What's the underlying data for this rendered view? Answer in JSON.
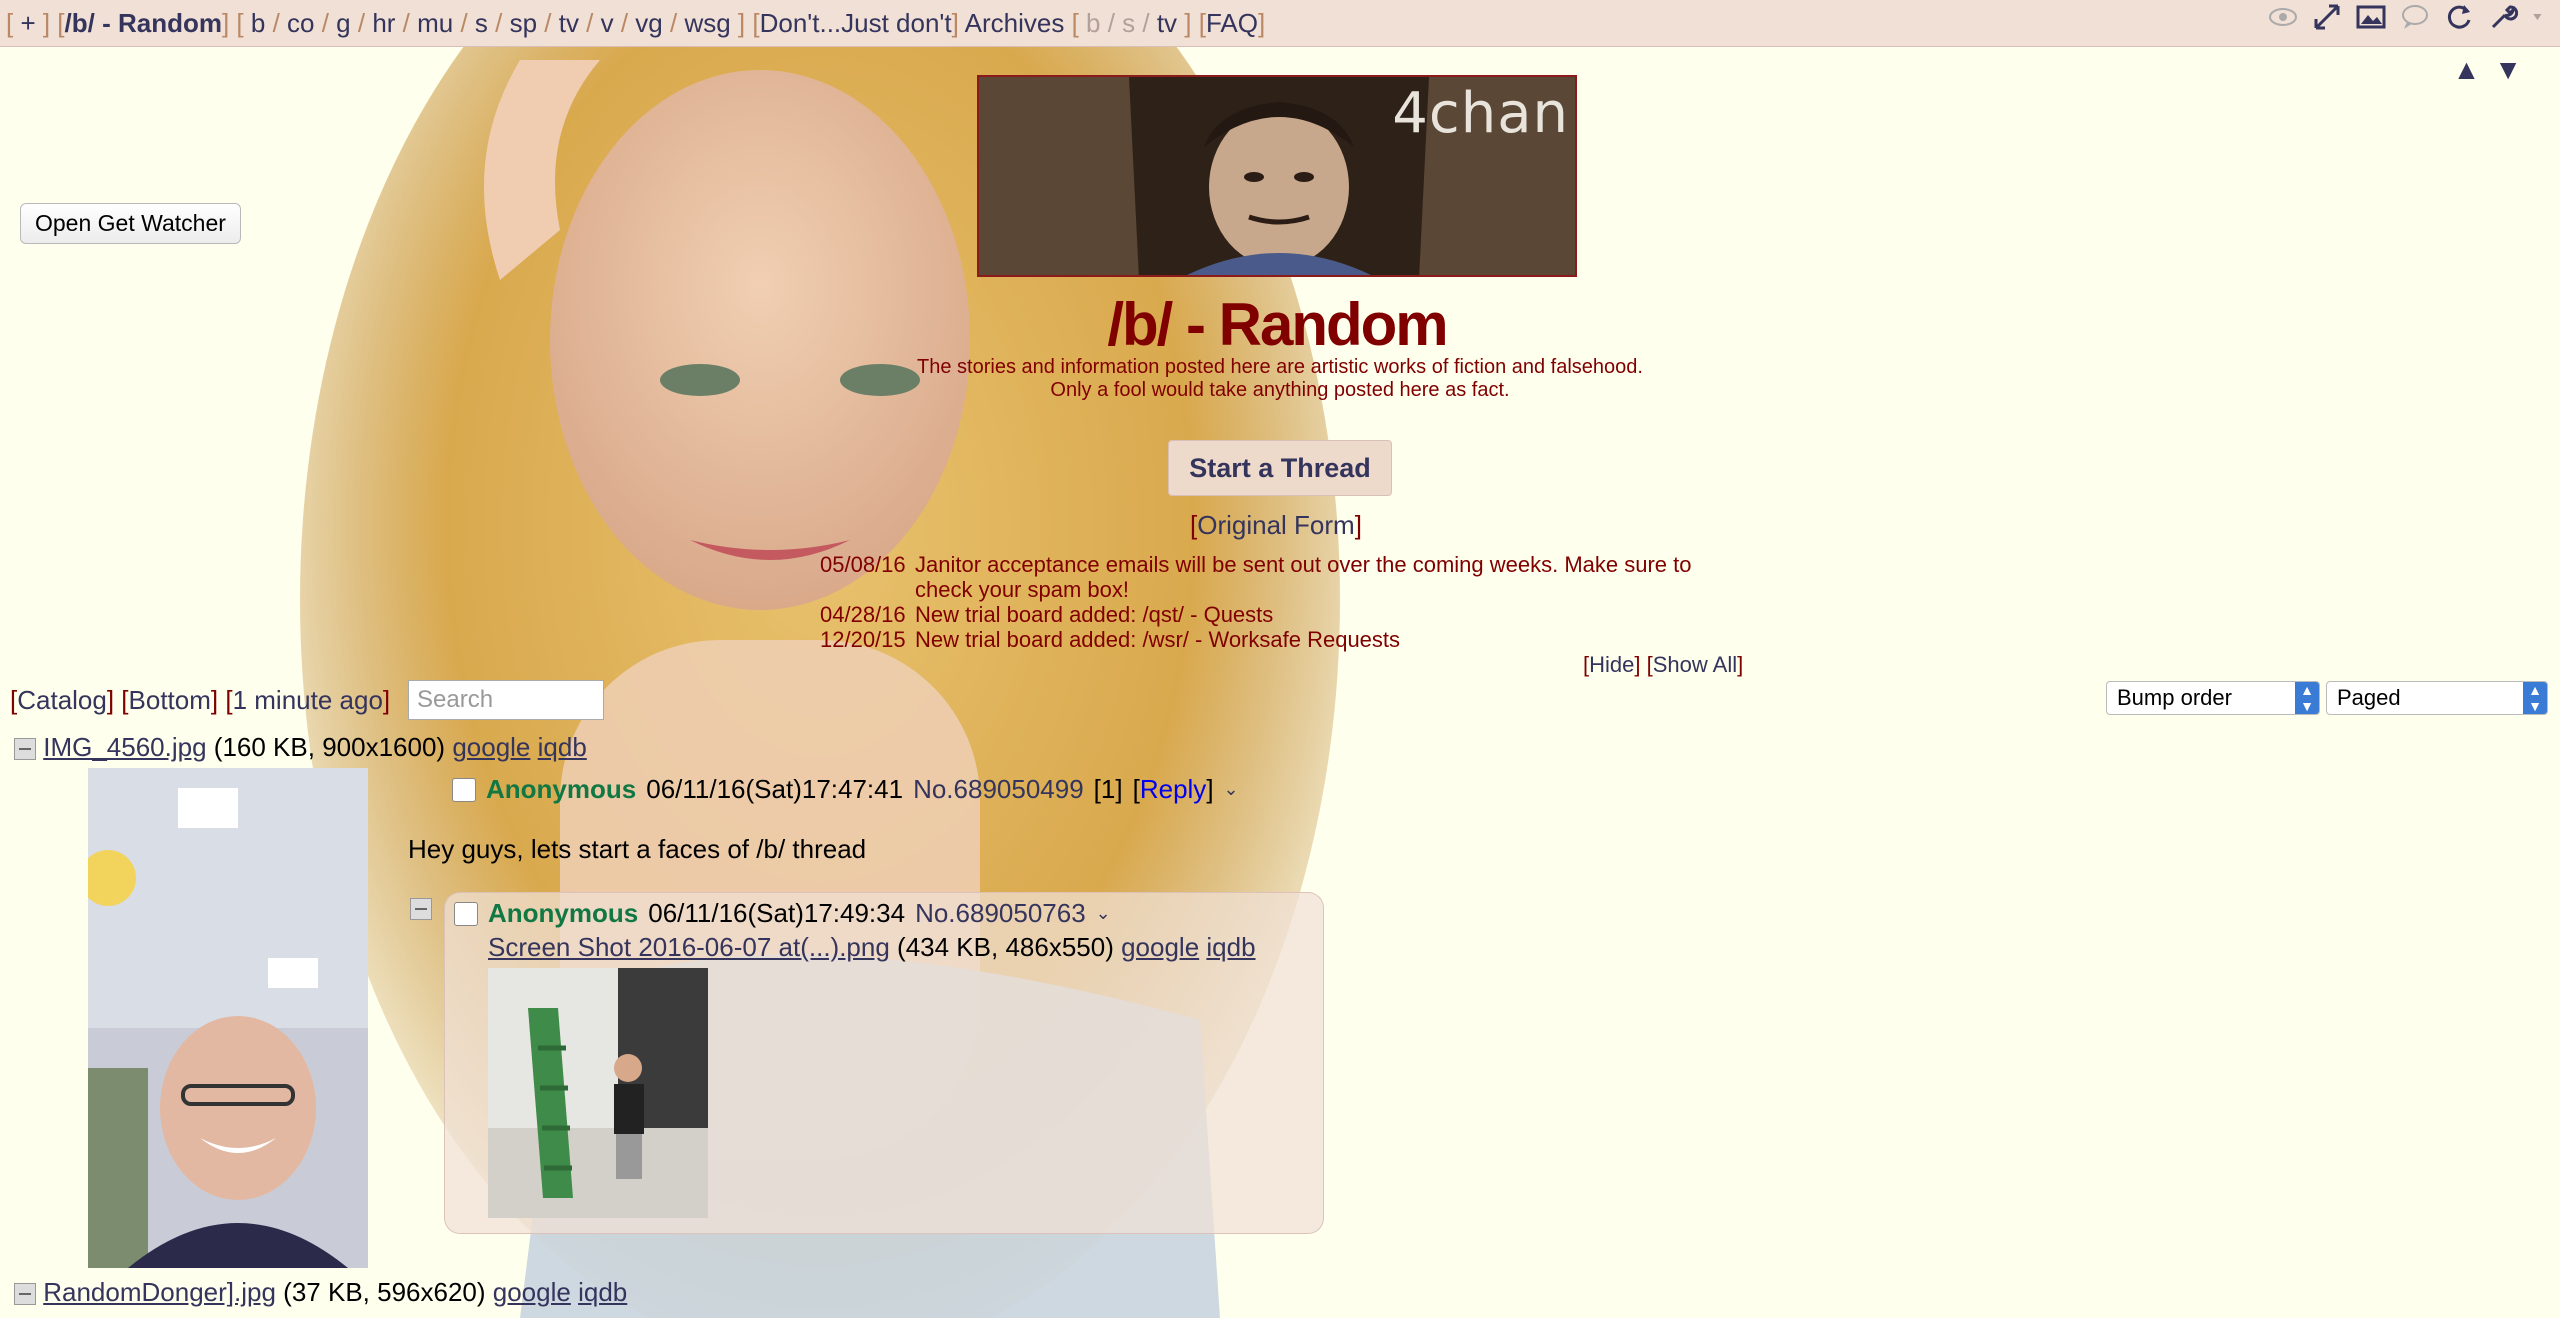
{
  "nav": {
    "add": "+",
    "current_board": "/b/ - Random",
    "boards": [
      "b",
      "co",
      "g",
      "hr",
      "mu",
      "s",
      "sp",
      "tv",
      "v",
      "vg",
      "wsg"
    ],
    "dont": "Don't...Just don't",
    "archives": "Archives",
    "archive_boards": [
      "b",
      "s",
      "tv"
    ],
    "faq": "FAQ",
    "icons": [
      "eye-icon",
      "expand-icon",
      "image-icon",
      "chat-icon",
      "refresh-icon",
      "wrench-icon",
      "menu-chevron-icon"
    ]
  },
  "scroll_arrows": {
    "up": "▲",
    "down": "▼"
  },
  "open_get_watcher": "Open Get Watcher",
  "banner_logo": "4chan",
  "board_title": "/b/ - Random",
  "subtitle": {
    "line1": "The stories and information posted here are artistic works of fiction and falsehood.",
    "line2": "Only a fool would take anything posted here as fact."
  },
  "start_thread": "Start a Thread",
  "original_form": "Original Form",
  "news": [
    {
      "date": "05/08/16",
      "text": "Janitor acceptance emails will be sent out over the coming weeks. Make sure to check your spam box!"
    },
    {
      "date": "04/28/16",
      "text": "New trial board added: /qst/ - Quests"
    },
    {
      "date": "12/20/15",
      "text": "New trial board added: /wsr/ - Worksafe Requests"
    }
  ],
  "hide": "Hide",
  "show_all": "Show All",
  "catalog": "Catalog",
  "bottom": "Bottom",
  "updated": "1 minute ago",
  "search_placeholder": "Search",
  "sort_select": "Bump order",
  "mode_select": "Paged",
  "op": {
    "file_name": "IMG_4560.jpg",
    "file_info": "(160 KB, 900x1600)",
    "google": "google",
    "iqdb": "iqdb",
    "name": "Anonymous",
    "datetime": "06/11/16(Sat)17:47:41",
    "post_no": "No.689050499",
    "replies": "[1]",
    "reply_link": "Reply",
    "text": "Hey guys, lets start a faces of /b/ thread"
  },
  "reply": {
    "name": "Anonymous",
    "datetime": "06/11/16(Sat)17:49:34",
    "post_no": "No.689050763",
    "file_name": "Screen Shot 2016-06-07 at(...).png",
    "file_info": "(434 KB, 486x550)",
    "google": "google",
    "iqdb": "iqdb"
  },
  "second_thread": {
    "file_name": "RandomDonger].jpg",
    "file_info": "(37 KB, 596x620)",
    "google": "google",
    "iqdb": "iqdb"
  }
}
